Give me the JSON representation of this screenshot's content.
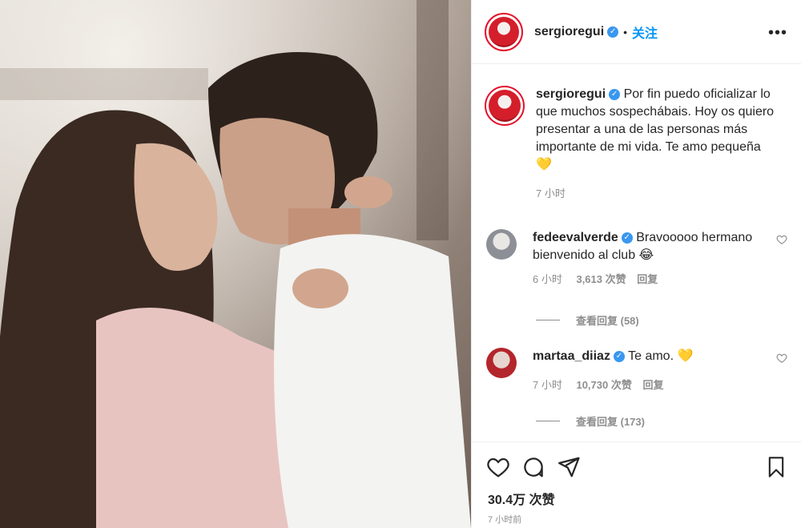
{
  "header": {
    "username": "sergioregui",
    "follow_label": "关注",
    "more_label": "•••"
  },
  "caption": {
    "username": "sergioregui",
    "text": "Por fin puedo oficializar lo que muchos sospechábais. Hoy os quiero presentar a una de las personas más importante de mi vida. Te amo pequeña",
    "emoji": "💛",
    "time": "7 小时"
  },
  "comments": [
    {
      "username": "fedeevalverde",
      "text": "Bravooooo hermano bienvenido al club",
      "emoji": "😂",
      "time": "6 小时",
      "likes": "3,613 次赞",
      "reply_label": "回复",
      "view_replies": "查看回复 (58)"
    },
    {
      "username": "martaa_diiaz",
      "text": "Te amo.",
      "emoji": "💛",
      "time": "7 小时",
      "likes": "10,730 次赞",
      "reply_label": "回复",
      "view_replies": "查看回复 (173)"
    }
  ],
  "footer": {
    "likes": "30.4万 次赞",
    "time_ago": "7 小时前"
  },
  "colors": {
    "accent_blue": "#0095f6",
    "verified_blue": "#3897f0",
    "muted_text": "#8e8e8e",
    "story_ring": "#e3102b"
  },
  "icons": {
    "like": "heart-icon",
    "comment": "comment-icon",
    "share": "send-icon",
    "save": "bookmark-icon",
    "verified": "verified-badge-icon"
  }
}
